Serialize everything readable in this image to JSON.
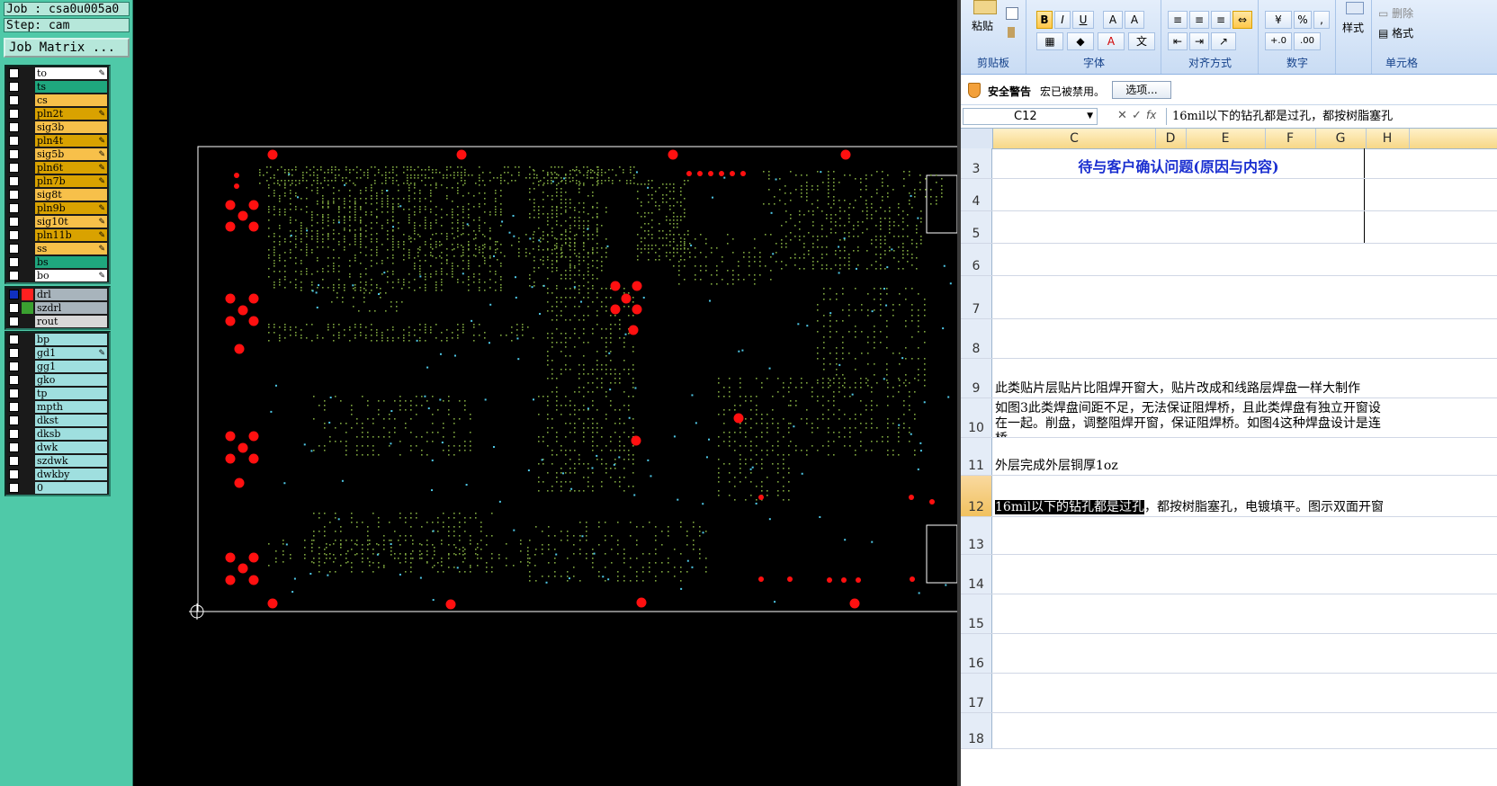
{
  "cam": {
    "job_line": "Job : csa0u005a0",
    "step_line": "Step: cam",
    "job_matrix": "Job Matrix ...",
    "layer_groups": [
      [
        {
          "name": "to",
          "color": "#ffffff",
          "pen": true
        },
        {
          "name": "ts",
          "color": "#1fa77e",
          "pen": false
        },
        {
          "name": "cs",
          "color": "#f7c04a",
          "pen": false
        },
        {
          "name": "pln2t",
          "color": "#d9a200",
          "pen": true
        },
        {
          "name": "sig3b",
          "color": "#f7c04a",
          "pen": false
        },
        {
          "name": "pln4t",
          "color": "#d9a200",
          "pen": true
        },
        {
          "name": "sig5b",
          "color": "#f7c04a",
          "pen": true
        },
        {
          "name": "pln6t",
          "color": "#d9a200",
          "pen": true
        },
        {
          "name": "pln7b",
          "color": "#d9a200",
          "pen": true
        },
        {
          "name": "sig8t",
          "color": "#f7c04a",
          "pen": false
        },
        {
          "name": "pln9b",
          "color": "#d9a200",
          "pen": true
        },
        {
          "name": "sig10t",
          "color": "#f7c04a",
          "pen": true
        },
        {
          "name": "pln11b",
          "color": "#d9a200",
          "pen": true
        },
        {
          "name": "ss",
          "color": "#f7c04a",
          "pen": true
        },
        {
          "name": "bs",
          "color": "#1fa77e",
          "pen": false
        },
        {
          "name": "bo",
          "color": "#ffffff",
          "pen": true
        }
      ],
      [
        {
          "name": "drl",
          "color": "#a8b4bc",
          "checked": true,
          "ind": "#ff2020"
        },
        {
          "name": "szdrl",
          "color": "#a8b4bc",
          "ind": "#3aa030"
        },
        {
          "name": "rout",
          "color": "#d8d8d8"
        }
      ],
      [
        {
          "name": "bp",
          "color": "#9fdfdf"
        },
        {
          "name": "gd1",
          "color": "#9fdfdf",
          "pen": true
        },
        {
          "name": "gg1",
          "color": "#9fdfdf"
        },
        {
          "name": "gko",
          "color": "#9fdfdf"
        },
        {
          "name": "tp",
          "color": "#9fdfdf"
        },
        {
          "name": "mpth",
          "color": "#9fdfdf"
        },
        {
          "name": "dkst",
          "color": "#9fdfdf"
        },
        {
          "name": "dksb",
          "color": "#9fdfdf"
        },
        {
          "name": "dwk",
          "color": "#9fdfdf"
        },
        {
          "name": "szdwk",
          "color": "#9fdfdf"
        },
        {
          "name": "dwkby",
          "color": "#9fdfdf"
        },
        {
          "name": "0",
          "color": "#9fdfdf"
        }
      ]
    ]
  },
  "pcb": {
    "pad_color": "#ff1010",
    "dot_color": "#7fa640",
    "accent_dot_color": "#4fc8e6",
    "outline_color": "#ffffff"
  },
  "excel": {
    "ribbon": {
      "groups": [
        "剪贴板",
        "字体",
        "对齐方式",
        "数字",
        "单元格"
      ],
      "paste_label": "粘贴",
      "style_label": "样式",
      "delete_label": "删除",
      "format_label": "格式",
      "bold": "B",
      "italic": "I",
      "underline": "U"
    },
    "security": {
      "title": "安全警告",
      "message": "宏已被禁用。",
      "options_button": "选项..."
    },
    "formula_bar": {
      "name_box": "C12",
      "fx": "fx",
      "content": "16mil以下的钻孔都是过孔，都按树脂塞孔"
    },
    "columns": [
      "C",
      "D",
      "E",
      "F",
      "G",
      "H"
    ],
    "rows": [
      {
        "num": "3",
        "text": "待与客户确认问题(原因与内容)",
        "style": "title"
      },
      {
        "num": "4",
        "text": ""
      },
      {
        "num": "5",
        "text": ""
      },
      {
        "num": "6",
        "text": ""
      },
      {
        "num": "7",
        "text": ""
      },
      {
        "num": "8",
        "text": ""
      },
      {
        "num": "9",
        "text": "此类贴片层贴片比阻焊开窗大，贴片改成和线路层焊盘一样大制作"
      },
      {
        "num": "10",
        "text": "如图3此类焊盘间距不足，无法保证阻焊桥，且此类焊盘有独立开窗设",
        "text2": "在一起。削盘，调整阻焊开窗，保证阻焊桥。如图4这种焊盘设计是连",
        "text3": "桥"
      },
      {
        "num": "11",
        "text": "外层完成外层铜厚1oz"
      },
      {
        "num": "12",
        "sel": "16mil以下的钻孔都是过孔",
        "text": "，都按树脂塞孔，电镀填平。图示双面开窗",
        "selected": true
      },
      {
        "num": "13",
        "text": ""
      },
      {
        "num": "14",
        "text": ""
      },
      {
        "num": "15",
        "text": ""
      },
      {
        "num": "16",
        "text": ""
      },
      {
        "num": "17",
        "text": ""
      },
      {
        "num": "18",
        "text": ""
      }
    ]
  }
}
